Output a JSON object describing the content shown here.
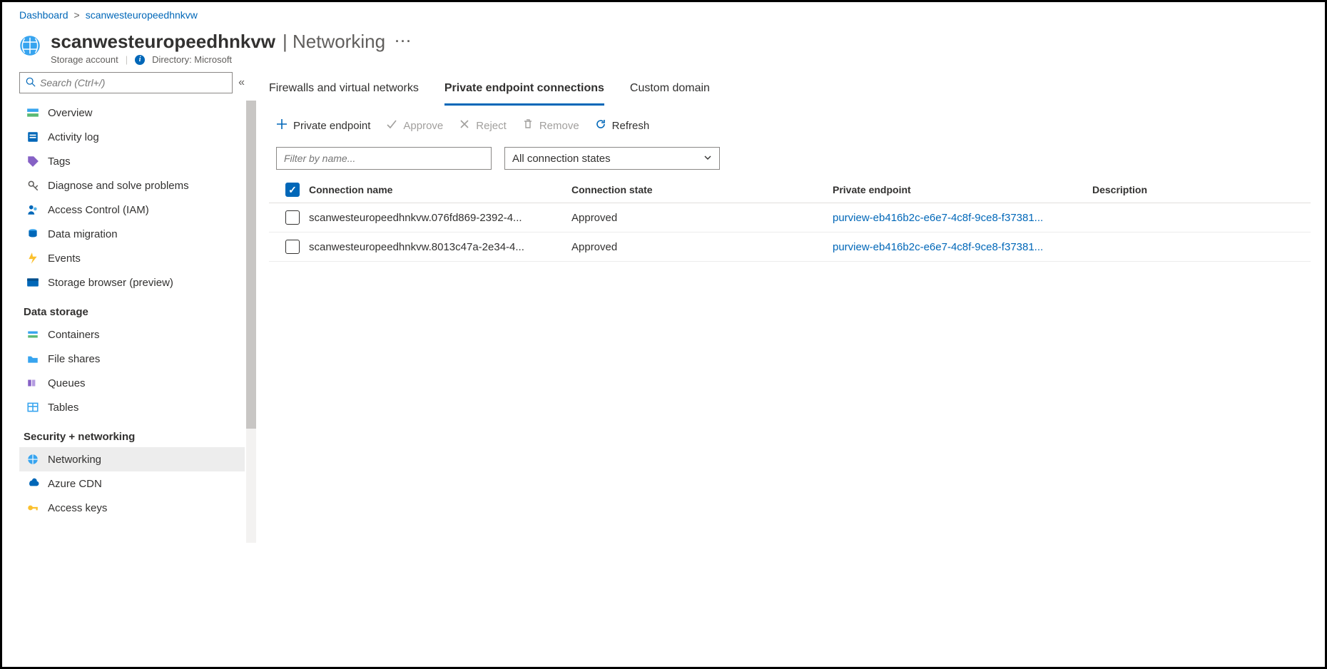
{
  "breadcrumb": {
    "root": "Dashboard",
    "current": "scanwesteuropeedhnkvw"
  },
  "header": {
    "title": "scanwesteuropeedhnkvw",
    "section": "Networking",
    "resource_type": "Storage account",
    "directory_label": "Directory: Microsoft"
  },
  "sidebar": {
    "search_placeholder": "Search (Ctrl+/)",
    "items_top": [
      {
        "label": "Overview",
        "icon": "overview"
      },
      {
        "label": "Activity log",
        "icon": "activity"
      },
      {
        "label": "Tags",
        "icon": "tags"
      },
      {
        "label": "Diagnose and solve problems",
        "icon": "diagnose"
      },
      {
        "label": "Access Control (IAM)",
        "icon": "iam"
      },
      {
        "label": "Data migration",
        "icon": "migration"
      },
      {
        "label": "Events",
        "icon": "events"
      },
      {
        "label": "Storage browser (preview)",
        "icon": "browser"
      }
    ],
    "section_storage": "Data storage",
    "items_storage": [
      {
        "label": "Containers",
        "icon": "containers"
      },
      {
        "label": "File shares",
        "icon": "fileshares"
      },
      {
        "label": "Queues",
        "icon": "queues"
      },
      {
        "label": "Tables",
        "icon": "tables"
      }
    ],
    "section_security": "Security + networking",
    "items_security": [
      {
        "label": "Networking",
        "icon": "networking",
        "selected": true
      },
      {
        "label": "Azure CDN",
        "icon": "cdn"
      },
      {
        "label": "Access keys",
        "icon": "keys"
      }
    ]
  },
  "tabs": {
    "firewalls": "Firewalls and virtual networks",
    "private": "Private endpoint connections",
    "custom": "Custom domain"
  },
  "toolbar": {
    "add": "Private endpoint",
    "approve": "Approve",
    "reject": "Reject",
    "remove": "Remove",
    "refresh": "Refresh"
  },
  "filters": {
    "name_placeholder": "Filter by name...",
    "state_selected": "All connection states"
  },
  "table": {
    "columns": {
      "name": "Connection name",
      "state": "Connection state",
      "endpoint": "Private endpoint",
      "desc": "Description"
    },
    "rows": [
      {
        "name": "scanwesteuropeedhnkvw.076fd869-2392-4...",
        "state": "Approved",
        "endpoint": "purview-eb416b2c-e6e7-4c8f-9ce8-f37381...",
        "desc": ""
      },
      {
        "name": "scanwesteuropeedhnkvw.8013c47a-2e34-4...",
        "state": "Approved",
        "endpoint": "purview-eb416b2c-e6e7-4c8f-9ce8-f37381...",
        "desc": ""
      }
    ]
  }
}
